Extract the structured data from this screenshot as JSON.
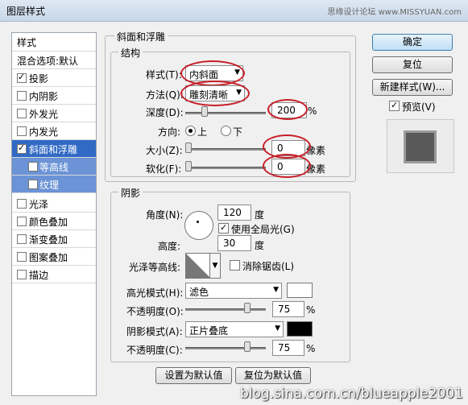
{
  "window": {
    "title": "图层样式",
    "watermark_top": "思缘设计论坛 www.MISSYUAN.com"
  },
  "styles_list": {
    "header": "样式",
    "blend": "混合选项:默认",
    "items": [
      {
        "label": "投影",
        "checked": true
      },
      {
        "label": "内阴影",
        "checked": false
      },
      {
        "label": "外发光",
        "checked": false
      },
      {
        "label": "内发光",
        "checked": false
      },
      {
        "label": "斜面和浮雕",
        "checked": true,
        "selected": true
      },
      {
        "label": "等高线",
        "checked": false,
        "sub": true
      },
      {
        "label": "纹理",
        "checked": false,
        "sub": true
      },
      {
        "label": "光泽",
        "checked": false
      },
      {
        "label": "颜色叠加",
        "checked": false
      },
      {
        "label": "渐变叠加",
        "checked": false
      },
      {
        "label": "图案叠加",
        "checked": false
      },
      {
        "label": "描边",
        "checked": false
      }
    ]
  },
  "bevel": {
    "title": "斜面和浮雕",
    "structure_title": "结构",
    "style_label": "样式(T):",
    "style_value": "内斜面",
    "method_label": "方法(Q):",
    "method_value": "雕刻清晰",
    "depth_label": "深度(D):",
    "depth_value": "200",
    "depth_unit": "%",
    "direction_label": "方向:",
    "dir_up": "上",
    "dir_down": "下",
    "direction_selected": "上",
    "size_label": "大小(Z):",
    "size_value": "0",
    "size_unit": "像素",
    "soften_label": "软化(F):",
    "soften_value": "0",
    "soften_unit": "像素"
  },
  "shading": {
    "title": "阴影",
    "angle_label": "角度(N):",
    "angle_value": "120",
    "angle_unit": "度",
    "global_light_label": "使用全局光(G)",
    "global_light_checked": true,
    "altitude_label": "高度:",
    "altitude_value": "30",
    "altitude_unit": "度",
    "gloss_label": "光泽等高线:",
    "antialias_label": "消除锯齿(L)",
    "antialias_checked": false,
    "highlight_label": "高光模式(H):",
    "highlight_value": "滤色",
    "highlight_color": "#ffffff",
    "opacity1_label": "不透明度(O):",
    "opacity1_value": "75",
    "opacity_unit": "%",
    "shadow_label": "阴影模式(A):",
    "shadow_value": "正片叠底",
    "shadow_color": "#000000",
    "opacity2_label": "不透明度(C):",
    "opacity2_value": "75"
  },
  "footer": {
    "make_default": "设置为默认值",
    "reset_default": "复位为默认值"
  },
  "buttons": {
    "ok": "确定",
    "reset": "复位",
    "new_style": "新建样式(W)...",
    "preview_label": "预览(V)",
    "preview_checked": true
  },
  "watermark_bottom": "blog.sina.com.cn/blueapple2001"
}
